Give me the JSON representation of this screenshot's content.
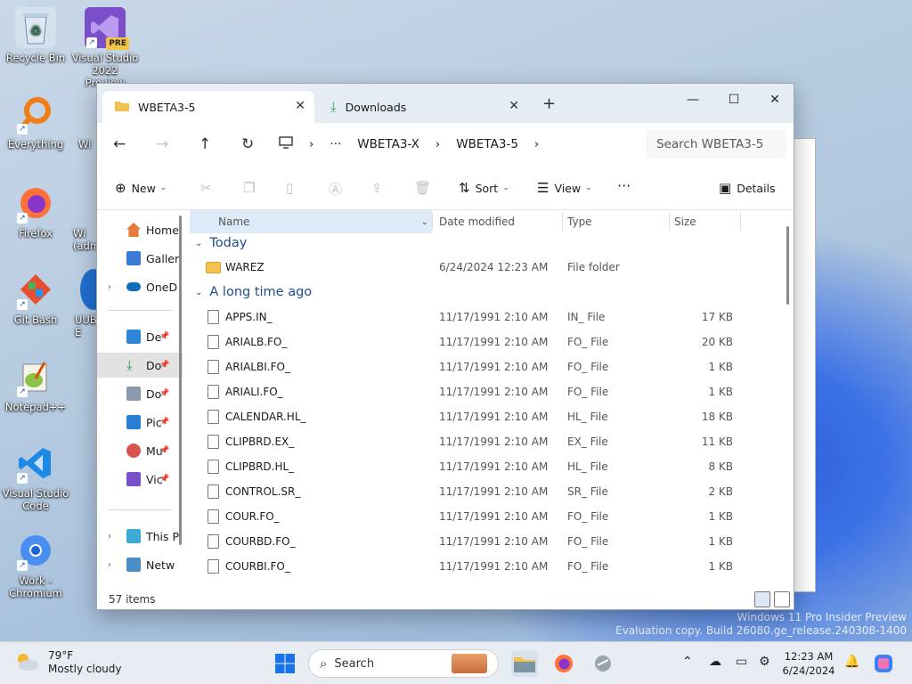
{
  "desktop": {
    "icons": [
      {
        "label": "Recycle Bin"
      },
      {
        "label": "Visual Studio 2022 Preview",
        "badge": "PRE"
      },
      {
        "label": "Everything"
      },
      {
        "label": "Firefox"
      },
      {
        "label": "Git Bash"
      },
      {
        "label": "Notepad++"
      },
      {
        "label": "Visual Studio Code"
      },
      {
        "label": "Work - Chromium"
      }
    ],
    "partial_labels": [
      "Wi",
      "Wi (adm",
      "UUB E"
    ],
    "watermark": {
      "line1": "Windows 11 Pro Insider Preview",
      "line2": "Evaluation copy. Build 26080.ge_release.240308-1400"
    }
  },
  "explorer": {
    "tabs": [
      {
        "title": "WBETA3-5",
        "icon": "folder-icon"
      },
      {
        "title": "Downloads",
        "icon": "download-icon"
      }
    ],
    "window_controls": {
      "minimize": "—",
      "maximize": "☐",
      "close": "✕",
      "new_tab": "+"
    },
    "address": {
      "more": "···",
      "segments": [
        "WBETA3-X",
        "WBETA3-5"
      ]
    },
    "search_placeholder": "Search WBETA3-5",
    "commands": {
      "new": "New",
      "sort": "Sort",
      "view": "View",
      "more": "···",
      "details": "Details"
    },
    "nav_pane": {
      "items": [
        {
          "label": "Home"
        },
        {
          "label": "Galler"
        },
        {
          "label": "OneD"
        },
        {
          "label": "De"
        },
        {
          "label": "Do"
        },
        {
          "label": "Do"
        },
        {
          "label": "Pic"
        },
        {
          "label": "Mu"
        },
        {
          "label": "Vic"
        },
        {
          "label": "This P"
        },
        {
          "label": "Netw"
        }
      ]
    },
    "columns": {
      "name": "Name",
      "date": "Date modified",
      "type": "Type",
      "size": "Size"
    },
    "groups": {
      "today": "Today",
      "old": "A long time ago"
    },
    "today_files": [
      {
        "name": "WAREZ",
        "date": "6/24/2024 12:23 AM",
        "type": "File folder",
        "size": ""
      }
    ],
    "old_files": [
      {
        "name": "APPS.IN_",
        "date": "11/17/1991 2:10 AM",
        "type": "IN_ File",
        "size": "17 KB"
      },
      {
        "name": "ARIALB.FO_",
        "date": "11/17/1991 2:10 AM",
        "type": "FO_ File",
        "size": "20 KB"
      },
      {
        "name": "ARIALBI.FO_",
        "date": "11/17/1991 2:10 AM",
        "type": "FO_ File",
        "size": "1 KB"
      },
      {
        "name": "ARIALI.FO_",
        "date": "11/17/1991 2:10 AM",
        "type": "FO_ File",
        "size": "1 KB"
      },
      {
        "name": "CALENDAR.HL_",
        "date": "11/17/1991 2:10 AM",
        "type": "HL_ File",
        "size": "18 KB"
      },
      {
        "name": "CLIPBRD.EX_",
        "date": "11/17/1991 2:10 AM",
        "type": "EX_ File",
        "size": "11 KB"
      },
      {
        "name": "CLIPBRD.HL_",
        "date": "11/17/1991 2:10 AM",
        "type": "HL_ File",
        "size": "8 KB"
      },
      {
        "name": "CONTROL.SR_",
        "date": "11/17/1991 2:10 AM",
        "type": "SR_ File",
        "size": "2 KB"
      },
      {
        "name": "COUR.FO_",
        "date": "11/17/1991 2:10 AM",
        "type": "FO_ File",
        "size": "1 KB"
      },
      {
        "name": "COURBD.FO_",
        "date": "11/17/1991 2:10 AM",
        "type": "FO_ File",
        "size": "1 KB"
      },
      {
        "name": "COURBI.FO_",
        "date": "11/17/1991 2:10 AM",
        "type": "FO_ File",
        "size": "1 KB"
      }
    ],
    "status": "57 items"
  },
  "taskbar": {
    "weather": {
      "temp": "79°F",
      "desc": "Mostly cloudy"
    },
    "search_label": "Search",
    "clock": {
      "time": "12:23 AM",
      "date": "6/24/2024"
    }
  },
  "colors": {
    "accent": "#0067c0",
    "folder": "#f3c14c",
    "taskbar": "#e8edf4"
  }
}
